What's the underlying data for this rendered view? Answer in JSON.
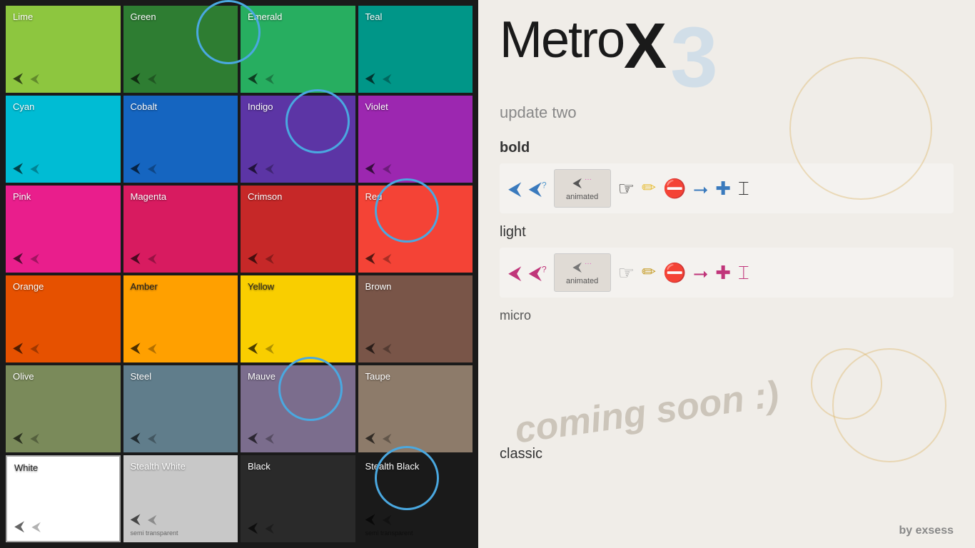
{
  "left": {
    "tiles": [
      {
        "label": "Lime",
        "color": "#8dc63f",
        "row": 1,
        "col": 1
      },
      {
        "label": "Green",
        "color": "#2e7d32",
        "row": 1,
        "col": 2
      },
      {
        "label": "Emerald",
        "color": "#27ae60",
        "row": 1,
        "col": 3
      },
      {
        "label": "Teal",
        "color": "#009688",
        "row": 1,
        "col": 4
      },
      {
        "label": "Cyan",
        "color": "#00bcd4",
        "row": 2,
        "col": 1
      },
      {
        "label": "Cobalt",
        "color": "#1565c0",
        "row": 2,
        "col": 2
      },
      {
        "label": "Indigo",
        "color": "#5c35a5",
        "row": 2,
        "col": 3
      },
      {
        "label": "Violet",
        "color": "#9c27b0",
        "row": 2,
        "col": 4
      },
      {
        "label": "Pink",
        "color": "#e91e8c",
        "row": 3,
        "col": 1
      },
      {
        "label": "Magenta",
        "color": "#d81b60",
        "row": 3,
        "col": 2
      },
      {
        "label": "Crimson",
        "color": "#c62828",
        "row": 3,
        "col": 3
      },
      {
        "label": "Red",
        "color": "#f44336",
        "row": 3,
        "col": 4
      },
      {
        "label": "Orange",
        "color": "#e65100",
        "row": 4,
        "col": 1
      },
      {
        "label": "Amber",
        "color": "#ffa000",
        "row": 4,
        "col": 2
      },
      {
        "label": "Yellow",
        "color": "#f9ce00",
        "row": 4,
        "col": 3
      },
      {
        "label": "Brown",
        "color": "#795548",
        "row": 4,
        "col": 4
      },
      {
        "label": "Olive",
        "color": "#7a8a5a",
        "row": 5,
        "col": 1
      },
      {
        "label": "Steel",
        "color": "#607d8b",
        "row": 5,
        "col": 2
      },
      {
        "label": "Mauve",
        "color": "#7b6d8d",
        "row": 5,
        "col": 3
      },
      {
        "label": "Taupe",
        "color": "#8d7b6a",
        "row": 5,
        "col": 4
      },
      {
        "label": "White",
        "color": "#ffffff",
        "row": 6,
        "col": 1,
        "light": true
      },
      {
        "label": "Stealth White",
        "color": "#c8c8c8",
        "row": 6,
        "col": 2
      },
      {
        "label": "Black",
        "color": "#2a2a2a",
        "row": 6,
        "col": 3
      },
      {
        "label": "Stealth Black",
        "color": "#1a1a1a",
        "row": 6,
        "col": 4
      }
    ]
  },
  "right": {
    "title": "Metro X",
    "update": "update two",
    "version_num": "3",
    "sections": [
      {
        "id": "bold",
        "label": "bold"
      },
      {
        "id": "light",
        "label": "light"
      },
      {
        "id": "micro",
        "label": "micro"
      },
      {
        "id": "classic",
        "label": "classic"
      }
    ],
    "animated_label": "animated",
    "coming_soon": "coming soon :)",
    "by": "by ",
    "exsess": "exsess"
  }
}
